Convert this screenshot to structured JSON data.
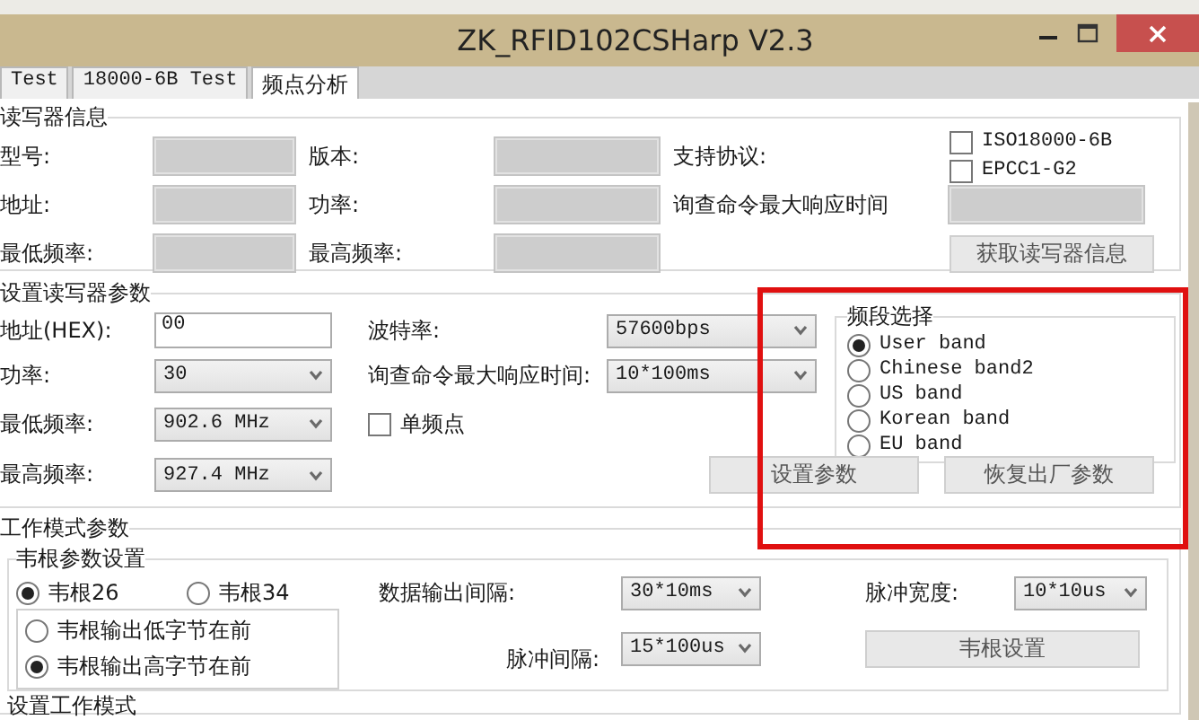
{
  "window": {
    "title": "ZK_RFID102CSHarp V2.3"
  },
  "tabs": [
    {
      "label": "Test",
      "selected": false
    },
    {
      "label": "18000-6B Test",
      "selected": false
    },
    {
      "label": "频点分析",
      "selected": true
    }
  ],
  "reader_info": {
    "title": "读写器信息",
    "fields": [
      {
        "label": "型号:",
        "disabled": true
      },
      {
        "label": "版本:",
        "disabled": true
      },
      {
        "label": "地址:",
        "disabled": true
      },
      {
        "label": "功率:",
        "disabled": true
      },
      {
        "label": "最低频率:",
        "disabled": true
      },
      {
        "label": "最高频率:",
        "disabled": true
      }
    ],
    "protocol_label": "支持协议:",
    "protocols": [
      {
        "label": "ISO18000-6B",
        "checked": false
      },
      {
        "label": "EPCC1-G2",
        "checked": false
      }
    ],
    "response": {
      "label": "询查命令最大响应时间",
      "disabled": true
    },
    "button": "获取读写器信息"
  },
  "reader_params": {
    "title": "设置读写器参数",
    "address": {
      "label": "地址(HEX):",
      "value": "00"
    },
    "baud": {
      "label": "波特率:",
      "value": "57600bps"
    },
    "power": {
      "label": "功率:",
      "value": "30"
    },
    "response_time": {
      "label": "询查命令最大响应时间:",
      "value": "10*100ms"
    },
    "min_freq": {
      "label": "最低频率:",
      "value": "902.6 MHz"
    },
    "single_freq": {
      "label": "单频点",
      "checked": false
    },
    "max_freq": {
      "label": "最高频率:",
      "value": "927.4 MHz"
    },
    "band_select": {
      "title": "频段选择",
      "options": [
        {
          "label": "User band",
          "selected": true
        },
        {
          "label": "Chinese band2",
          "selected": false
        },
        {
          "label": "US band",
          "selected": false
        },
        {
          "label": "Korean band",
          "selected": false
        },
        {
          "label": "EU band",
          "selected": false
        }
      ]
    },
    "buttons": [
      "设置参数",
      "恢复出厂参数"
    ]
  },
  "work_mode": {
    "title": "工作模式参数",
    "wiegand": {
      "title": "韦根参数设置",
      "formats": [
        {
          "label": "韦根26",
          "selected": true
        },
        {
          "label": "韦根34",
          "selected": false
        }
      ],
      "byte_order": [
        {
          "label": "韦根输出低字节在前",
          "selected": false
        },
        {
          "label": "韦根输出高字节在前",
          "selected": true
        }
      ],
      "output_interval": {
        "label": "数据输出间隔:",
        "value": "30*10ms"
      },
      "pulse_width": {
        "label": "脉冲宽度:",
        "value": "10*10us"
      },
      "pulse_interval": {
        "label": "脉冲间隔:",
        "value": "15*100us"
      },
      "button": "韦根设置"
    }
  },
  "next_group_title": "设置工作模式"
}
